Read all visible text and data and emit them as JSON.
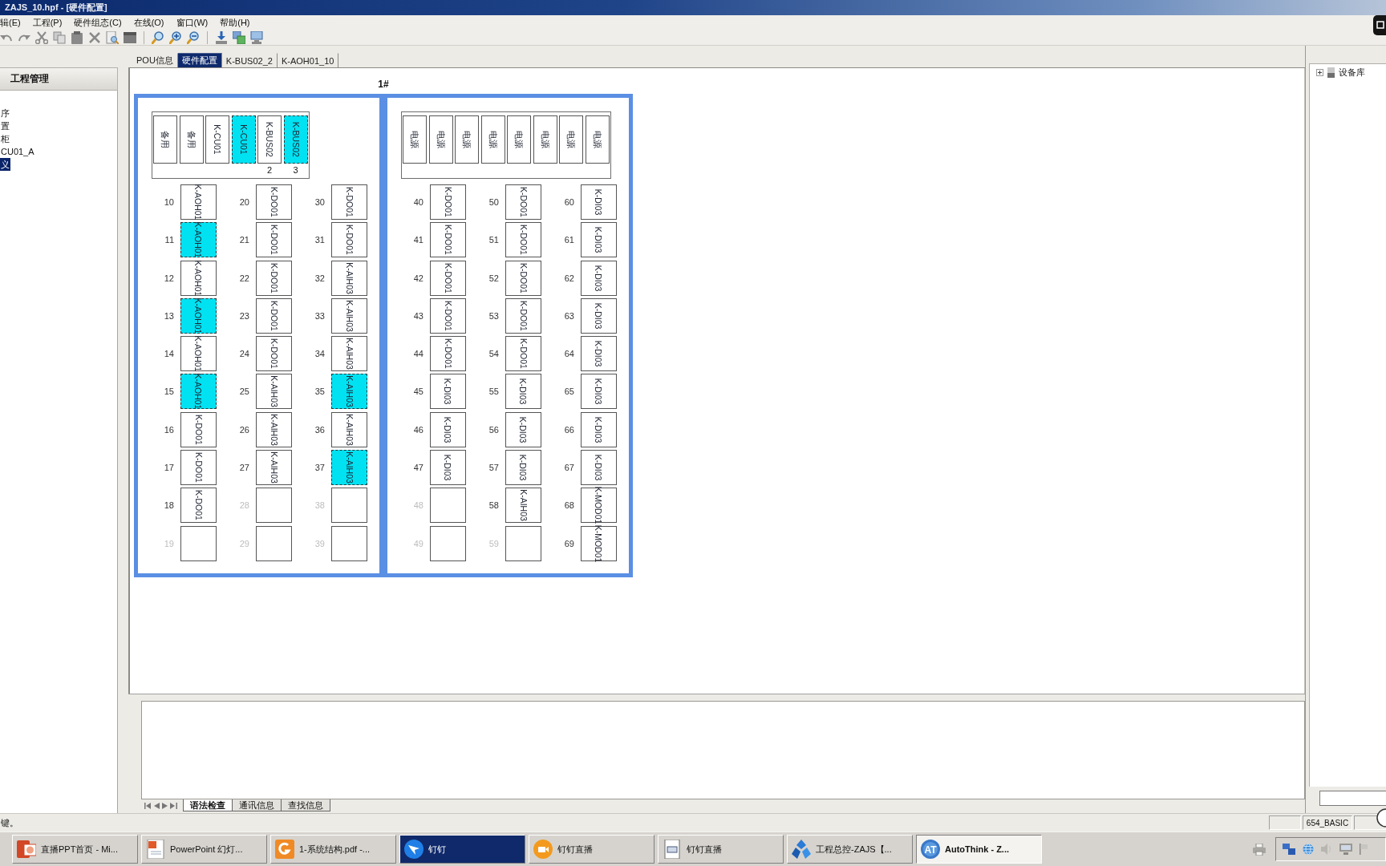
{
  "window": {
    "title": "ZAJS_10.hpf - [硬件配置]"
  },
  "menu": [
    "辑(E)",
    "工程(P)",
    "硬件组态(C)",
    "在线(O)",
    "窗口(W)",
    "帮助(H)"
  ],
  "project_panel": {
    "title": "工程管理",
    "items": [
      {
        "label": "序",
        "selected": false
      },
      {
        "label": "置",
        "selected": false
      },
      {
        "label": "柜",
        "selected": false
      },
      {
        "label": "CU01_A",
        "selected": false
      },
      {
        "label": "义",
        "selected": true
      }
    ]
  },
  "editor_tabs": [
    {
      "label": "POU信息",
      "selected": false
    },
    {
      "label": "硬件配置",
      "selected": true
    },
    {
      "label": "K-BUS02_2",
      "selected": false
    },
    {
      "label": "K-AOH01_10",
      "selected": false
    }
  ],
  "rack": {
    "title": "1#",
    "cabinets": [
      {
        "base_modules": [
          {
            "name": "备用",
            "selected": false
          },
          {
            "name": "备用",
            "selected": false
          },
          {
            "name": "K-CU01",
            "selected": false
          },
          {
            "name": "K-CU01",
            "selected": true
          },
          {
            "name": "K-BUS02",
            "selected": false,
            "slot": "2"
          },
          {
            "name": "K-BUS02",
            "selected": true,
            "slot": "3"
          }
        ],
        "slot_columns": [
          [
            {
              "number": "10",
              "module": "K-AOH01",
              "empty": false,
              "selected": false
            },
            {
              "number": "11",
              "module": "K-AOH01",
              "empty": false,
              "selected": true
            },
            {
              "number": "12",
              "module": "K-AOH01",
              "empty": false,
              "selected": false
            },
            {
              "number": "13",
              "module": "K-AOH01",
              "empty": false,
              "selected": true
            },
            {
              "number": "14",
              "module": "K-AOH01",
              "empty": false,
              "selected": false
            },
            {
              "number": "15",
              "module": "K-AOH01",
              "empty": false,
              "selected": true
            },
            {
              "number": "16",
              "module": "K-DO01",
              "empty": false,
              "selected": false
            },
            {
              "number": "17",
              "module": "K-DO01",
              "empty": false,
              "selected": false
            },
            {
              "number": "18",
              "module": "K-DO01",
              "empty": false,
              "selected": false
            },
            {
              "number": "19",
              "empty": true,
              "selected": false
            }
          ],
          [
            {
              "number": "20",
              "module": "K-DO01",
              "empty": false,
              "selected": false
            },
            {
              "number": "21",
              "module": "K-DO01",
              "empty": false,
              "selected": false
            },
            {
              "number": "22",
              "module": "K-DO01",
              "empty": false,
              "selected": false
            },
            {
              "number": "23",
              "module": "K-DO01",
              "empty": false,
              "selected": false
            },
            {
              "number": "24",
              "module": "K-DO01",
              "empty": false,
              "selected": false
            },
            {
              "number": "25",
              "module": "K-AIH03",
              "empty": false,
              "selected": false
            },
            {
              "number": "26",
              "module": "K-AIH03",
              "empty": false,
              "selected": false
            },
            {
              "number": "27",
              "module": "K-AIH03",
              "empty": false,
              "selected": false
            },
            {
              "number": "28",
              "empty": true,
              "selected": false
            },
            {
              "number": "29",
              "empty": true,
              "selected": false
            }
          ],
          [
            {
              "number": "30",
              "module": "K-DO01",
              "empty": false,
              "selected": false
            },
            {
              "number": "31",
              "module": "K-DO01",
              "empty": false,
              "selected": false
            },
            {
              "number": "32",
              "module": "K-AIH03",
              "empty": false,
              "selected": false
            },
            {
              "number": "33",
              "module": "K-AIH03",
              "empty": false,
              "selected": false
            },
            {
              "number": "34",
              "module": "K-AIH03",
              "empty": false,
              "selected": false
            },
            {
              "number": "35",
              "module": "K-AIH03",
              "empty": false,
              "selected": true
            },
            {
              "number": "36",
              "module": "K-AIH03",
              "empty": false,
              "selected": false
            },
            {
              "number": "37",
              "module": "K-AIH03",
              "empty": false,
              "selected": true
            },
            {
              "number": "38",
              "empty": true,
              "selected": false
            },
            {
              "number": "39",
              "empty": true,
              "selected": false
            }
          ]
        ]
      },
      {
        "base_modules": [
          {
            "name": "电源",
            "selected": false
          },
          {
            "name": "电源",
            "selected": false
          },
          {
            "name": "电源",
            "selected": false
          },
          {
            "name": "电源",
            "selected": false
          },
          {
            "name": "电源",
            "selected": false
          },
          {
            "name": "电源",
            "selected": false
          },
          {
            "name": "电源",
            "selected": false
          },
          {
            "name": "电源",
            "selected": false
          }
        ],
        "slot_columns": [
          [
            {
              "number": "40",
              "module": "K-DO01",
              "empty": false,
              "selected": false
            },
            {
              "number": "41",
              "module": "K-DO01",
              "empty": false,
              "selected": false
            },
            {
              "number": "42",
              "module": "K-DO01",
              "empty": false,
              "selected": false
            },
            {
              "number": "43",
              "module": "K-DO01",
              "empty": false,
              "selected": false
            },
            {
              "number": "44",
              "module": "K-DO01",
              "empty": false,
              "selected": false
            },
            {
              "number": "45",
              "module": "K-DI03",
              "empty": false,
              "selected": false
            },
            {
              "number": "46",
              "module": "K-DI03",
              "empty": false,
              "selected": false
            },
            {
              "number": "47",
              "module": "K-DI03",
              "empty": false,
              "selected": false
            },
            {
              "number": "48",
              "empty": true,
              "selected": false
            },
            {
              "number": "49",
              "empty": true,
              "selected": false
            }
          ],
          [
            {
              "number": "50",
              "module": "K-DO01",
              "empty": false,
              "selected": false
            },
            {
              "number": "51",
              "module": "K-DO01",
              "empty": false,
              "selected": false
            },
            {
              "number": "52",
              "module": "K-DO01",
              "empty": false,
              "selected": false
            },
            {
              "number": "53",
              "module": "K-DO01",
              "empty": false,
              "selected": false
            },
            {
              "number": "54",
              "module": "K-DO01",
              "empty": false,
              "selected": false
            },
            {
              "number": "55",
              "module": "K-DI03",
              "empty": false,
              "selected": false
            },
            {
              "number": "56",
              "module": "K-DI03",
              "empty": false,
              "selected": false
            },
            {
              "number": "57",
              "module": "K-DI03",
              "empty": false,
              "selected": false
            },
            {
              "number": "58",
              "module": "K-AIH03",
              "empty": false,
              "selected": false
            },
            {
              "number": "59",
              "empty": true,
              "selected": false
            }
          ],
          [
            {
              "number": "60",
              "module": "K-DI03",
              "empty": false,
              "selected": false
            },
            {
              "number": "61",
              "module": "K-DI03",
              "empty": false,
              "selected": false
            },
            {
              "number": "62",
              "module": "K-DI03",
              "empty": false,
              "selected": false
            },
            {
              "number": "63",
              "module": "K-DI03",
              "empty": false,
              "selected": false
            },
            {
              "number": "64",
              "module": "K-DI03",
              "empty": false,
              "selected": false
            },
            {
              "number": "65",
              "module": "K-DI03",
              "empty": false,
              "selected": false
            },
            {
              "number": "66",
              "module": "K-DI03",
              "empty": false,
              "selected": false
            },
            {
              "number": "67",
              "module": "K-DI03",
              "empty": false,
              "selected": false
            },
            {
              "number": "68",
              "module": "K-MOD01",
              "empty": false,
              "selected": false
            },
            {
              "number": "69",
              "module": "K-MOD01",
              "empty": false,
              "selected": false
            }
          ]
        ]
      }
    ]
  },
  "output_tabs": [
    {
      "label": "语法检查",
      "selected": true
    },
    {
      "label": "通讯信息",
      "selected": false
    },
    {
      "label": "查找信息",
      "selected": false
    }
  ],
  "device_panel": {
    "items": [
      {
        "label": "设备库",
        "expanded": false
      }
    ]
  },
  "status_bar": {
    "message": "键。",
    "fields": [
      "654_BASIC"
    ]
  },
  "taskbar": {
    "items": [
      {
        "label": "直播PPT首页 - Mi...",
        "kind": "powerpoint",
        "selected": false,
        "flashing": false
      },
      {
        "label": "PowerPoint 幻灯...",
        "kind": "slides",
        "selected": false,
        "flashing": false
      },
      {
        "label": "1-系统结构.pdf -...",
        "kind": "pdf",
        "selected": false,
        "flashing": false
      },
      {
        "label": "钉钉",
        "kind": "dingtalk",
        "selected": false,
        "flashing": true
      },
      {
        "label": "钉钉直播",
        "kind": "live",
        "selected": false,
        "flashing": false
      },
      {
        "label": "钉钉直播",
        "kind": "document",
        "selected": false,
        "flashing": false
      },
      {
        "label": "工程总控-ZAJS【...",
        "kind": "network",
        "selected": false,
        "flashing": false
      },
      {
        "label": "AutoThink - Z...",
        "kind": "autothink",
        "selected": true,
        "flashing": false,
        "icon_text": "AT"
      }
    ]
  }
}
